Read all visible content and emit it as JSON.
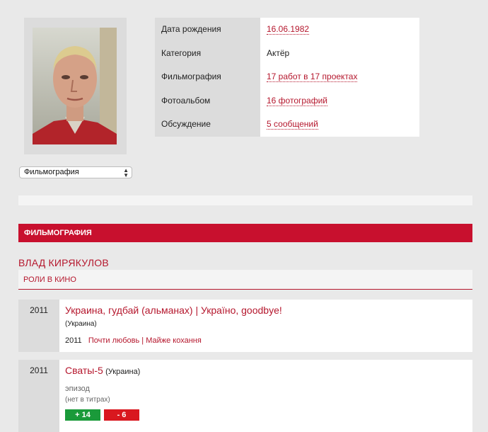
{
  "profile": {
    "select_value": "Фильмография",
    "info": [
      {
        "label": "Дата рождения",
        "value": "16.06.1982",
        "link": true
      },
      {
        "label": "Категория",
        "value": "Актёр",
        "link": false
      },
      {
        "label": "Фильмография",
        "value": "17 работ в 17 проектах",
        "link": true
      },
      {
        "label": "Фотоальбом",
        "value": "16 фотографий",
        "link": true
      },
      {
        "label": "Обсуждение",
        "value": "5 сообщений",
        "link": true
      }
    ]
  },
  "section": {
    "header": "ФИЛЬМОГРАФИЯ",
    "person_name": "ВЛАД КИРЯКУЛОВ",
    "roles_label": "РОЛИ В КИНО"
  },
  "films": [
    {
      "year": "2011",
      "title": "Украина, гудбай (альманах) | Україно, goodbye!",
      "country": "(Украина)",
      "segment_year": "2011",
      "segment_title": "Почти любовь | Майже кохання"
    },
    {
      "year": "2011",
      "title": "Сваты-5",
      "country": "(Украина)",
      "role": "эпизод",
      "credit": "(нет в титрах)",
      "votes_plus": "+ 14",
      "votes_minus": "- 6"
    }
  ],
  "colors": {
    "accent": "#c8102e",
    "link": "#b5172d",
    "plus": "#1a9a3a",
    "minus": "#d9181f"
  }
}
